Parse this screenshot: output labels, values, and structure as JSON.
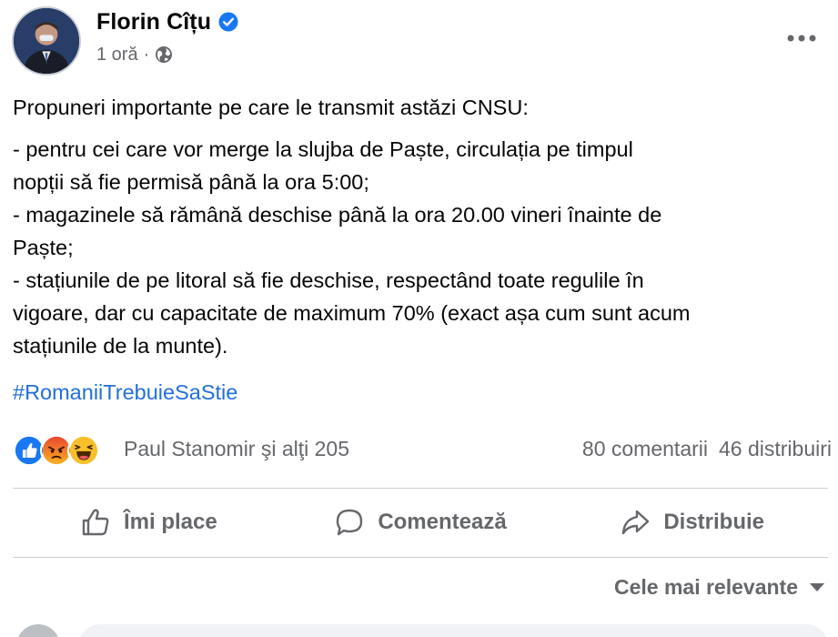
{
  "post": {
    "author": "Florin Cîțu",
    "time": "1 oră",
    "separator": "·",
    "text": {
      "intro": "Propuneri importante pe care le transmit astăzi CNSU:",
      "bullets": "- pentru cei care vor merge la slujba de Paște, circulația pe timpul\nnopții să fie permisă până la ora 5:00;\n- magazinele să rămână deschise până la ora 20.00 vineri înainte de\nPaște;\n- stațiunile de pe litoral să fie deschise, respectând toate regulile în\nvigoare, dar cu capacitate de maximum 70% (exact așa cum sunt acum\nstațiunile de la munte)."
    },
    "hashtag": "#RomaniiTrebuieSaStie"
  },
  "reactions": {
    "icons": [
      "like-icon",
      "angry-icon",
      "haha-icon"
    ],
    "summary": "Paul Stanomir şi alţi 205",
    "comments": "80 comentarii",
    "shares": "46 distribuiri"
  },
  "actions": {
    "like": "Îmi place",
    "comment": "Comentează",
    "share": "Distribuie"
  },
  "sort": {
    "label": "Cele mai relevante"
  },
  "colors": {
    "link": "#216fdb",
    "secondary_text": "#65676b",
    "verified": "#1877f2",
    "divider": "#ced0d4"
  }
}
